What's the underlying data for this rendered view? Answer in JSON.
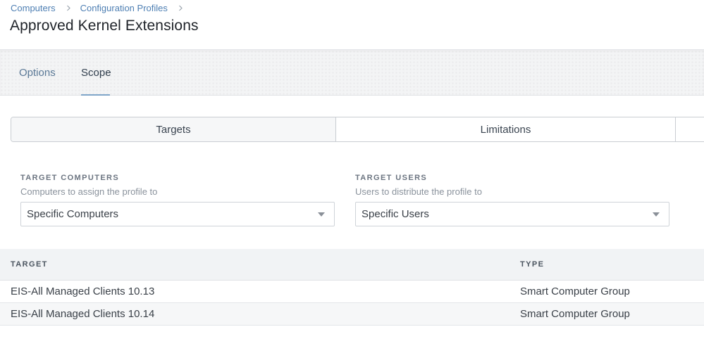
{
  "breadcrumb": {
    "items": [
      "Computers",
      "Configuration Profiles"
    ]
  },
  "page_title": "Approved Kernel Extensions",
  "tabs": [
    {
      "label": "Options",
      "active": false
    },
    {
      "label": "Scope",
      "active": true
    }
  ],
  "segmented": {
    "targets_label": "Targets",
    "limitations_label": "Limitations",
    "selected": "Targets"
  },
  "target_computers": {
    "label": "TARGET COMPUTERS",
    "help": "Computers to assign the profile to",
    "value": "Specific Computers"
  },
  "target_users": {
    "label": "TARGET USERS",
    "help": "Users to distribute the profile to",
    "value": "Specific Users"
  },
  "table": {
    "columns": [
      "TARGET",
      "TYPE"
    ],
    "rows": [
      {
        "target": "EIS-All Managed Clients 10.13",
        "type": "Smart Computer Group"
      },
      {
        "target": "EIS-All Managed Clients 10.14",
        "type": "Smart Computer Group"
      }
    ]
  },
  "icons": {
    "breadcrumb_separator": "chevron-right-icon",
    "select_caret": "caret-down-icon"
  },
  "colors": {
    "link": "#4e7fb3",
    "tab_underline": "#7fa6c9",
    "table_header_bg": "#f1f3f5"
  }
}
